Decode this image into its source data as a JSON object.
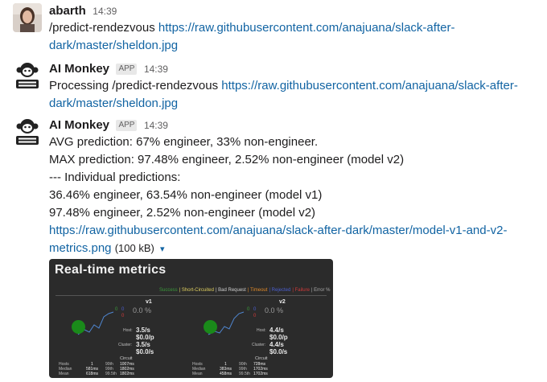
{
  "messages": [
    {
      "author": "abarth",
      "app_badge": "",
      "time": "14:39",
      "lines": [
        {
          "prefix": "/predict-rendezvous ",
          "link": "https://raw.githubusercontent.com/anajuana/slack-after-"
        },
        {
          "prefix": "",
          "link": "dark/master/sheldon.jpg"
        }
      ]
    },
    {
      "author": "AI Monkey",
      "app_badge": "APP",
      "time": "14:39",
      "lines": [
        {
          "prefix": "Processing /predict-rendezvous ",
          "link": "https://raw.githubusercontent.com/anajuana/slack-after-"
        },
        {
          "prefix": "",
          "link": "dark/master/sheldon.jpg"
        }
      ]
    },
    {
      "author": "AI Monkey",
      "app_badge": "APP",
      "time": "14:39",
      "lines": [
        "AVG prediction: 67% engineer, 33% non-engineer.",
        "MAX prediction: 97.48% engineer, 2.52% non-engineer (model v2)",
        "--- Individual predictions:",
        "36.46% engineer, 63.54% non-engineer (model v1)",
        "97.48% engineer, 2.52% non-engineer (model v2)"
      ],
      "attachment": {
        "link_line1": "https://raw.githubusercontent.com/anajuana/slack-after-dark/master/model-v1-and-v2-",
        "link_line2": "metrics.png",
        "size": "(100 kB)",
        "caret": "▾"
      }
    }
  ],
  "metrics_image": {
    "title": "Real-time metrics",
    "legend": [
      {
        "label": "Success",
        "color": "#3a9a3a"
      },
      {
        "label": "| Short-Circuited",
        "color": "#e0d060"
      },
      {
        "label": "| Bad Request",
        "color": "#d0d0d0"
      },
      {
        "label": "| Timeout",
        "color": "#e08a2a"
      },
      {
        "label": "| Rejected",
        "color": "#4b5fd0"
      },
      {
        "label": "| Failure",
        "color": "#d03a3a"
      },
      {
        "label": "| Error %",
        "color": "#aaaaaa"
      }
    ],
    "panels": [
      {
        "name": "v1",
        "pct": "0.0 %",
        "counts": [
          "0",
          "0",
          "0"
        ],
        "host_rate": "3.5/s",
        "host_label": "Host:",
        "cost": "$0.0/p",
        "cluster_rate": "3.5/s",
        "cluster_label": "Cluster:",
        "cost2": "$0.0/s",
        "circuit": "Circuit",
        "stats": [
          [
            "Hosts",
            "1",
            "90th",
            "1007ms"
          ],
          [
            "Median",
            "581ms",
            "99th",
            "1802ms"
          ],
          [
            "Mean",
            "618ms",
            "99.5th",
            "1802ms"
          ]
        ]
      },
      {
        "name": "v2",
        "pct": "0.0 %",
        "counts": [
          "0",
          "0",
          "0"
        ],
        "host_rate": "4.4/s",
        "host_label": "Host:",
        "cost": "$0.0/p",
        "cluster_rate": "4.4/s",
        "cluster_label": "Cluster:",
        "cost2": "$0.0/s",
        "circuit": "Circuit",
        "stats": [
          [
            "Hosts",
            "1",
            "90th",
            "728ms"
          ],
          [
            "Median",
            "383ms",
            "99th",
            "1702ms"
          ],
          [
            "Mean",
            "458ms",
            "99.5th",
            "1702ms"
          ]
        ]
      }
    ]
  }
}
